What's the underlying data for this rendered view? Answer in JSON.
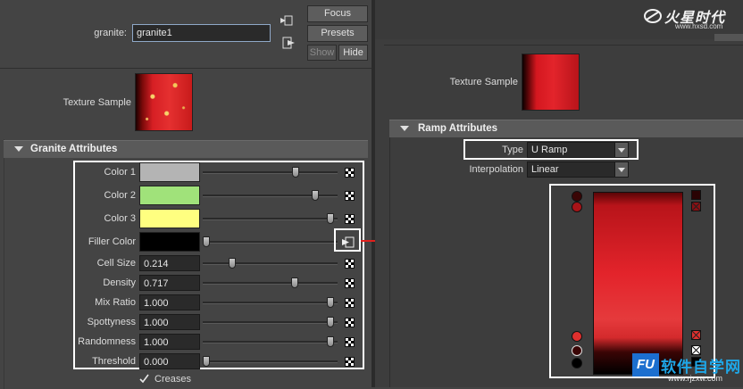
{
  "left": {
    "granite_label": "granite:",
    "granite_value": "granite1",
    "buttons": {
      "focus": "Focus",
      "presets": "Presets",
      "show": "Show",
      "hide": "Hide"
    },
    "texture_sample_label": "Texture Sample",
    "section_title": "Granite Attributes",
    "attrs": [
      {
        "label": "Color 1",
        "value": "",
        "swatch": "#b4b4b4",
        "slider_fraction": 0.7
      },
      {
        "label": "Color 2",
        "value": "",
        "swatch": "#a0e27a",
        "slider_fraction": 0.85
      },
      {
        "label": "Color 3",
        "value": "",
        "swatch": "#ffff80",
        "slider_fraction": 0.97
      },
      {
        "label": "Filler Color",
        "value": "",
        "swatch": "#000000",
        "slider_fraction": 0.0
      },
      {
        "label": "Cell Size",
        "value": "0.214",
        "slider_fraction": 0.2
      },
      {
        "label": "Density",
        "value": "0.717",
        "slider_fraction": 0.69
      },
      {
        "label": "Mix Ratio",
        "value": "1.000",
        "slider_fraction": 0.97
      },
      {
        "label": "Spottyness",
        "value": "1.000",
        "slider_fraction": 0.97
      },
      {
        "label": "Randomness",
        "value": "1.000",
        "slider_fraction": 0.97
      },
      {
        "label": "Threshold",
        "value": "0.000",
        "slider_fraction": 0.0
      }
    ],
    "creases_label": "Creases",
    "creases_checked": true
  },
  "right": {
    "logo_text": "火星时代",
    "logo_url": "www.hxsd.com",
    "texture_sample_label": "Texture Sample",
    "section_title": "Ramp Attributes",
    "type_label": "Type",
    "type_value": "U Ramp",
    "interpolation_label": "Interpolation",
    "interpolation_value": "Linear",
    "watermark_text": "软件自学网",
    "watermark_prefix": "FU",
    "watermark_url": "www.rjzxw.com"
  },
  "colors": {
    "highlight": "#ffffff",
    "arrow": "#e0201c",
    "ramp_red": "#e3242b"
  }
}
